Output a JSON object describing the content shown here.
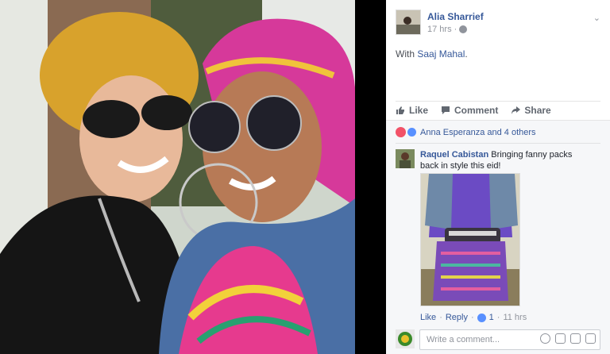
{
  "post": {
    "author": "Alia Sharrief",
    "time": "17 hrs",
    "with_prefix": "With",
    "with_name": "Saaj Mahal",
    "with_suffix": "."
  },
  "actions": {
    "like": "Like",
    "comment": "Comment",
    "share": "Share"
  },
  "reactions": {
    "text": "Anna Esperanza and 4 others"
  },
  "comment": {
    "author": "Raquel Cabistan",
    "text": "Bringing fanny packs back in style this eid!",
    "like": "Like",
    "sep": "·",
    "reply": "Reply",
    "like_count": "1",
    "time": "11 hrs"
  },
  "write": {
    "placeholder": "Write a comment..."
  },
  "colors": {
    "link": "#365899",
    "meta": "#90949c",
    "heart": "#f25268",
    "like": "#5890ff"
  }
}
